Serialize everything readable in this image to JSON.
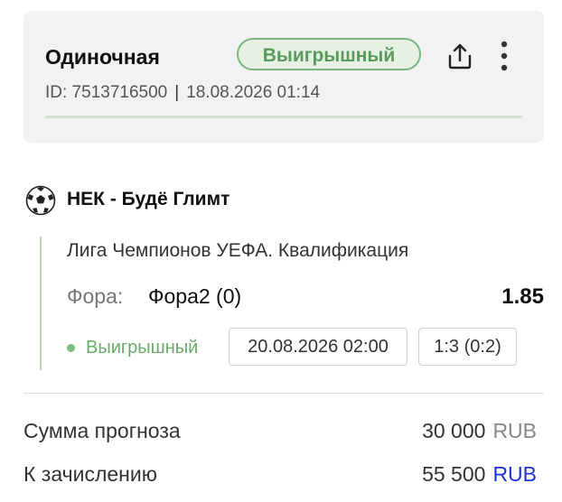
{
  "bet": {
    "type": "Одиночная",
    "status": "Выигрышный",
    "id_text": "ID: 7513716500",
    "separator": "|",
    "datetime": "18.08.2026 01:14"
  },
  "event": {
    "title": "НЕК - Будё Глимт",
    "league": "Лига Чемпионов УЕФА. Квалификация",
    "market_label": "Фора:",
    "market_value": "Фора2 (0)",
    "odds": "1.85",
    "status": "Выигрышный",
    "date": "20.08.2026 02:00",
    "score": "1:3 (0:2)",
    "sport_icon": "soccer-ball-icon"
  },
  "summary": {
    "stake_label": "Сумма прогноза",
    "stake_amount": "30 000",
    "stake_currency": "RUB",
    "payout_label": "К зачислению",
    "payout_amount": "55 500",
    "payout_currency": "RUB"
  },
  "colors": {
    "win_green": "#5a9a5d",
    "card_bg": "#f2f2f2",
    "accent_blue": "#1a33d6"
  }
}
